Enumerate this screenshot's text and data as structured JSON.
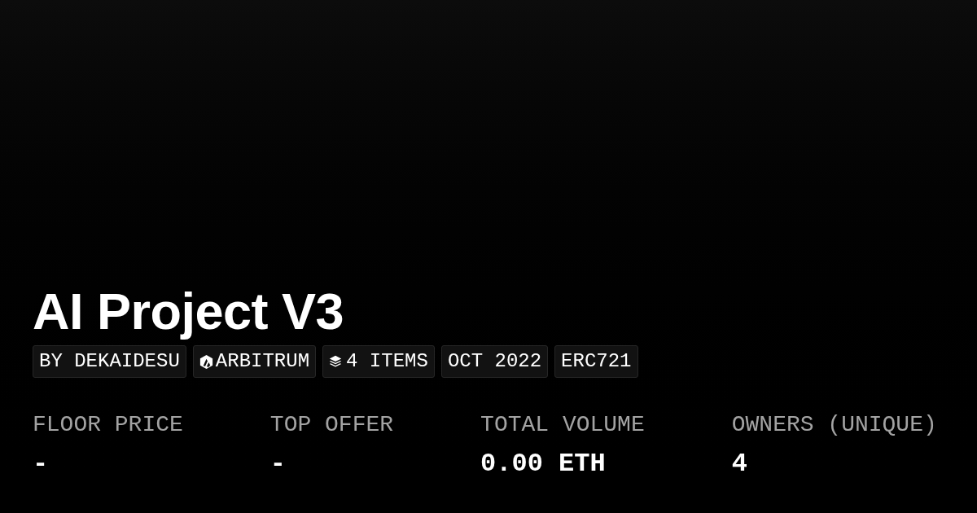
{
  "title": "AI Project V3",
  "tags": [
    {
      "kind": "text",
      "label": "BY DEKAIDESU"
    },
    {
      "kind": "chain",
      "label": "ARBITRUM"
    },
    {
      "kind": "items",
      "label": "4 ITEMS"
    },
    {
      "kind": "text",
      "label": "OCT 2022"
    },
    {
      "kind": "text",
      "label": "ERC721"
    }
  ],
  "stats": [
    {
      "label": "FLOOR PRICE",
      "value": "-"
    },
    {
      "label": "TOP OFFER",
      "value": "-"
    },
    {
      "label": "TOTAL VOLUME",
      "value": "0.00 ETH"
    },
    {
      "label": "OWNERS (UNIQUE)",
      "value": "4"
    }
  ]
}
